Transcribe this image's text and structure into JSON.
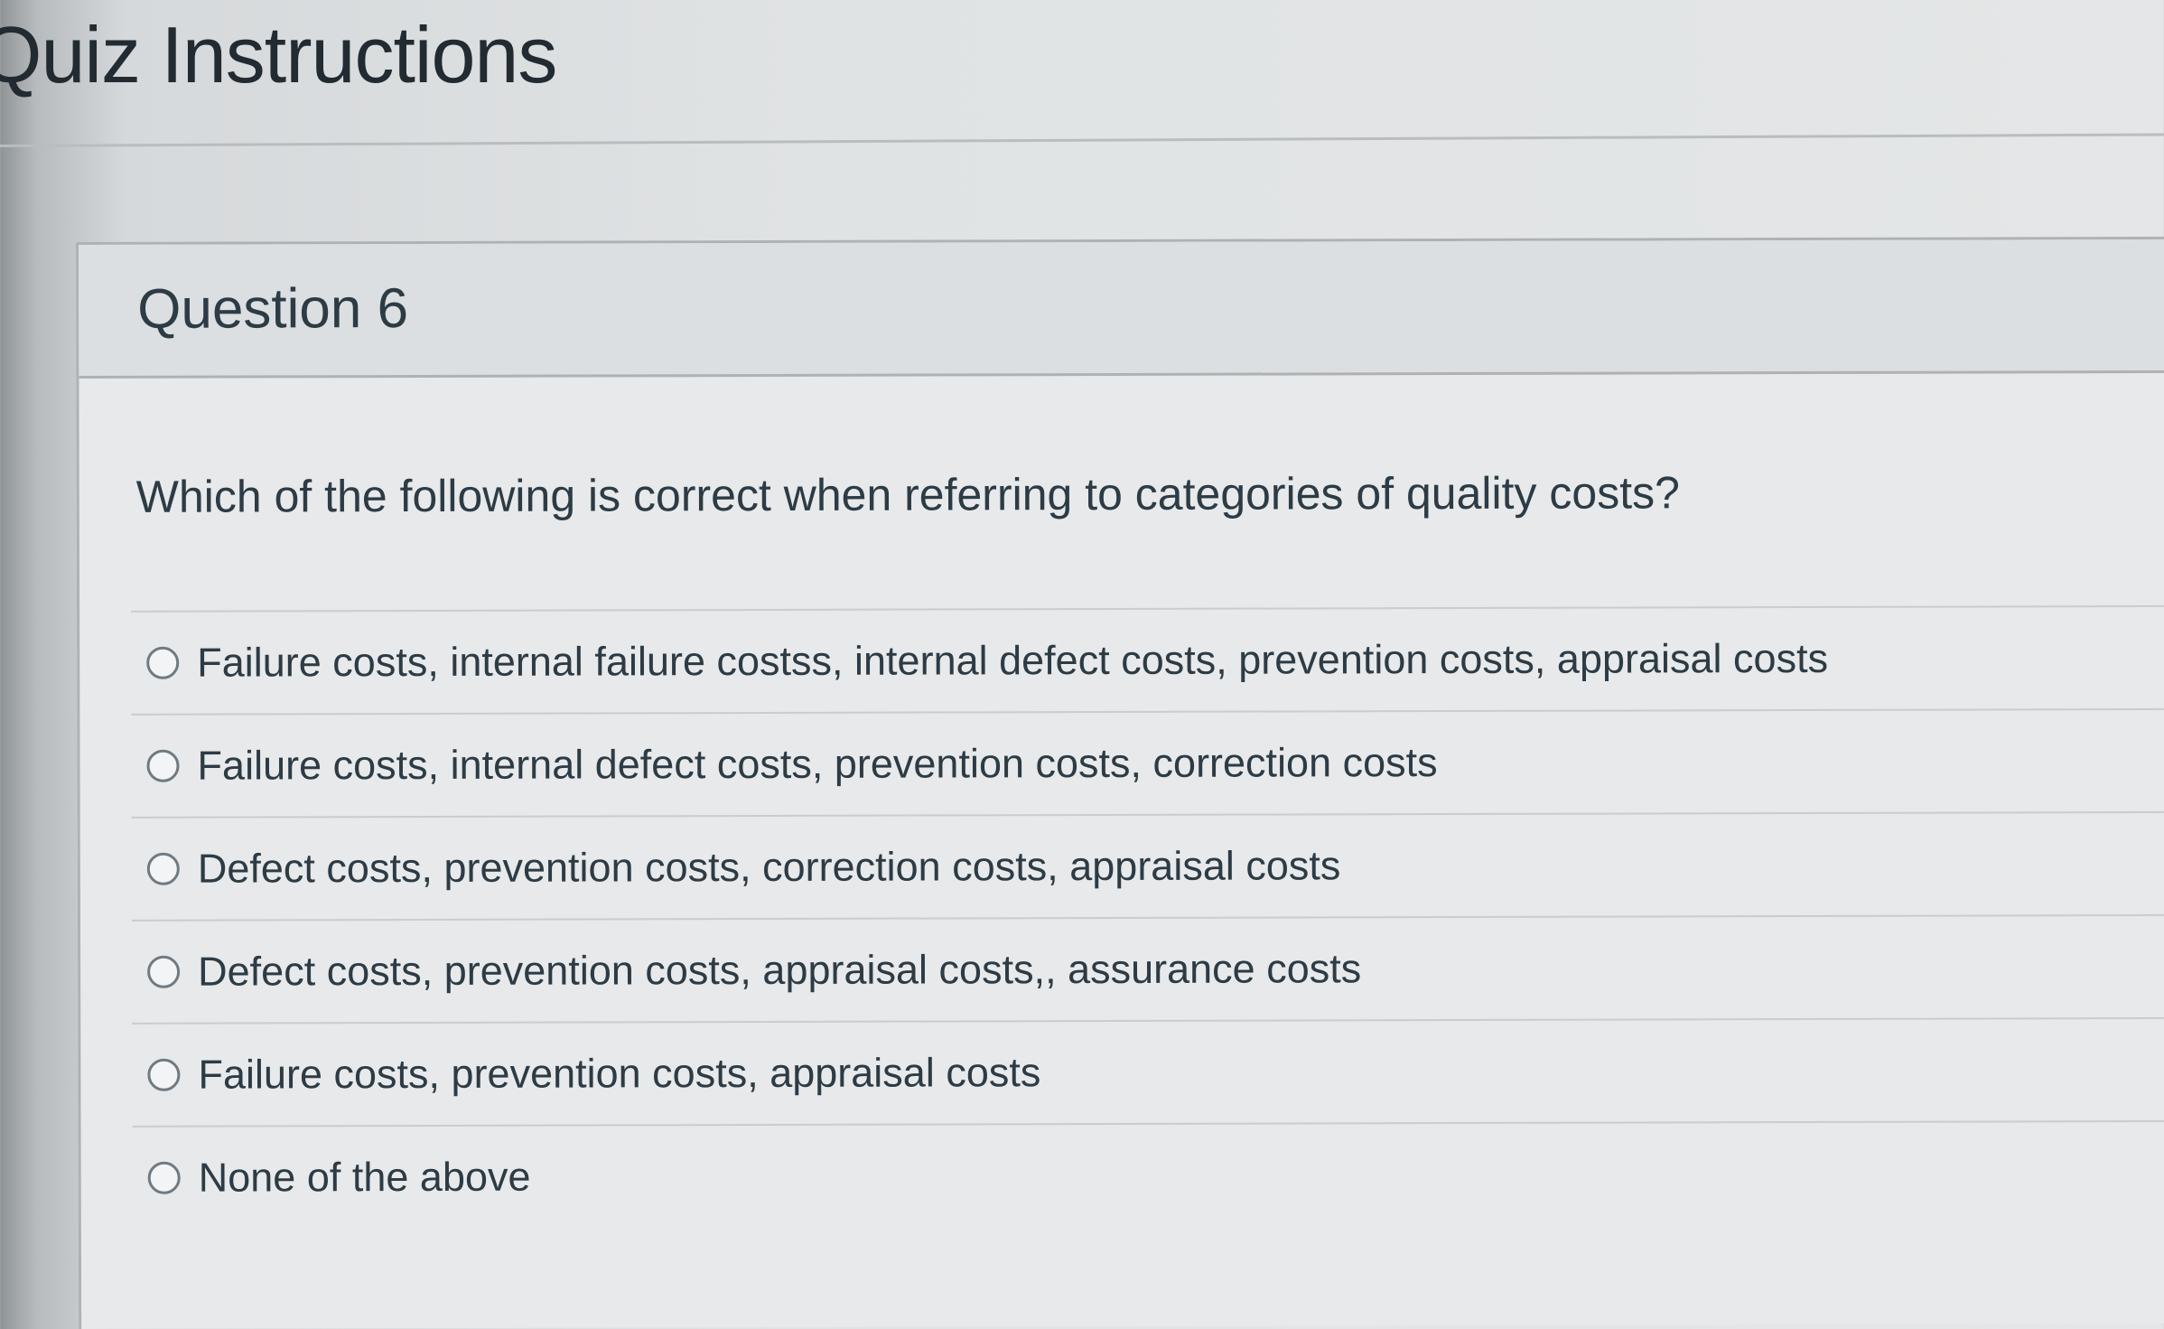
{
  "page": {
    "title": "Quiz Instructions"
  },
  "question": {
    "number_label": "Question 6",
    "text": "Which of the following is correct when referring to categories of quality costs?",
    "answers": [
      "Failure costs, internal failure costss, internal defect costs, prevention costs, appraisal costs",
      "Failure costs, internal defect costs, prevention costs, correction costs",
      "Defect costs, prevention costs, correction costs, appraisal costs",
      "Defect costs, prevention costs, appraisal costs,, assurance costs",
      "Failure costs, prevention costs, appraisal costs",
      "None of the above"
    ]
  }
}
